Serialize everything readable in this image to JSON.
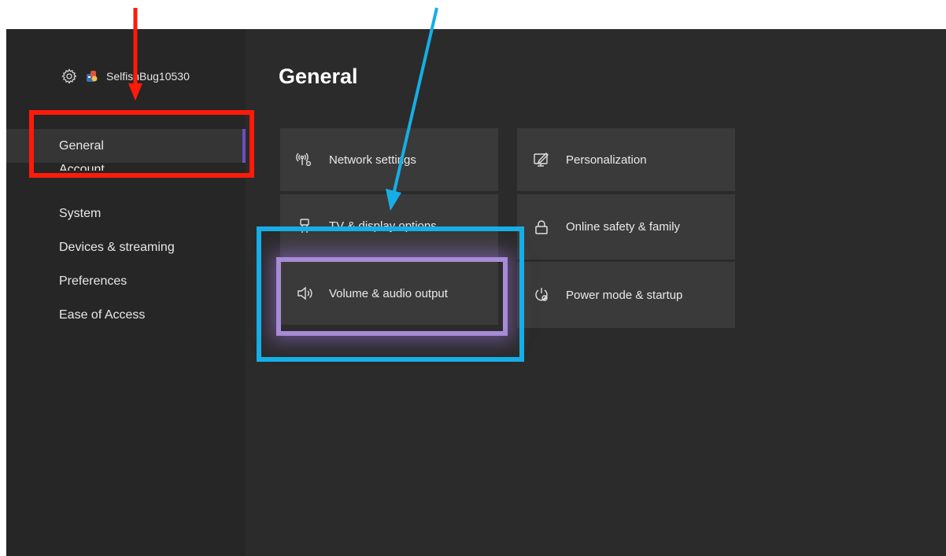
{
  "profile": {
    "gamertag": "SelfishBug10530"
  },
  "page": {
    "title": "General"
  },
  "nav": [
    {
      "label": "General",
      "selected": true
    },
    {
      "label": "Account"
    },
    {
      "label": "System"
    },
    {
      "label": "Devices & streaming"
    },
    {
      "label": "Preferences"
    },
    {
      "label": "Ease of Access"
    }
  ],
  "tiles": {
    "network": "Network settings",
    "tv": "TV & display options",
    "volume": "Volume & audio output",
    "personalization": "Personalization",
    "safety": "Online safety & family",
    "power": "Power mode & startup"
  },
  "colors": {
    "accent_purple": "#6b4fc4",
    "focus_ring": "#a78bd6",
    "annotation_red": "#ff1a0a",
    "annotation_blue": "#16aee6"
  }
}
